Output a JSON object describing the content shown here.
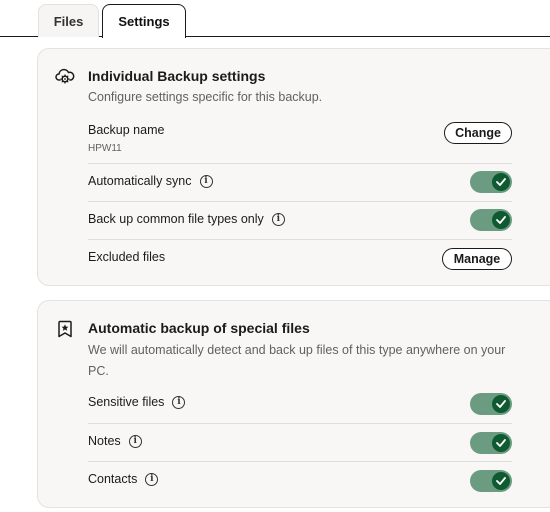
{
  "tabs": [
    {
      "label": "Files",
      "active": false
    },
    {
      "label": "Settings",
      "active": true
    }
  ],
  "backup_settings": {
    "icon": "cloud-gear-icon",
    "title": "Individual Backup settings",
    "description": "Configure settings specific for this backup.",
    "backup_name_label": "Backup name",
    "backup_name_value": "HPW11",
    "change_button": "Change",
    "auto_sync_label": "Automatically sync",
    "auto_sync_on": true,
    "common_types_label": "Back up common file types only",
    "common_types_on": true,
    "excluded_label": "Excluded files",
    "manage_button": "Manage"
  },
  "special_files": {
    "icon": "star-bookmark-icon",
    "title": "Automatic backup of special files",
    "description": "We will automatically detect and back up files of this type anywhere on your PC.",
    "items": [
      {
        "label": "Sensitive files",
        "on": true
      },
      {
        "label": "Notes",
        "on": true
      },
      {
        "label": "Contacts",
        "on": true
      }
    ]
  },
  "colors": {
    "toggle_track": "#6b9c82",
    "toggle_knob": "#0f5a31"
  }
}
